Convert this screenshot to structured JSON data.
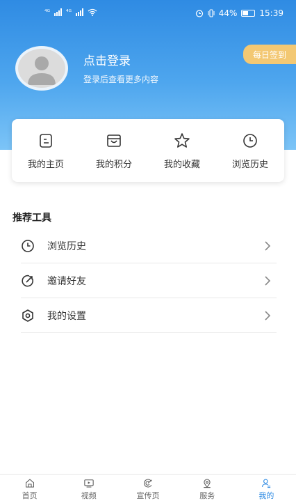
{
  "status_bar": {
    "signal_left": "⁴ᴳ",
    "signal_right": "⁴ᴳ",
    "battery": "44%",
    "time": "15:39"
  },
  "profile": {
    "title": "点击登录",
    "subtitle": "登录后查看更多内容",
    "daily_checkin": "每日签到"
  },
  "quick_actions": [
    {
      "label": "我的主页",
      "icon": "homepage-icon"
    },
    {
      "label": "我的积分",
      "icon": "bag-icon"
    },
    {
      "label": "我的收藏",
      "icon": "star-icon"
    },
    {
      "label": "浏览历史",
      "icon": "clock-icon"
    }
  ],
  "tools": {
    "title": "推荐工具",
    "items": [
      {
        "label": "浏览历史",
        "icon": "clock-icon"
      },
      {
        "label": "邀请好友",
        "icon": "refresh-icon"
      },
      {
        "label": "我的设置",
        "icon": "settings-icon"
      }
    ]
  },
  "tabs": [
    {
      "label": "首页",
      "icon": "home-icon"
    },
    {
      "label": "视频",
      "icon": "tv-icon"
    },
    {
      "label": "宣传页",
      "icon": "swirl-icon"
    },
    {
      "label": "服务",
      "icon": "location-icon"
    },
    {
      "label": "我的",
      "icon": "user-icon"
    }
  ],
  "colors": {
    "primary": "#2f8be3",
    "accent": "#f3c873"
  }
}
